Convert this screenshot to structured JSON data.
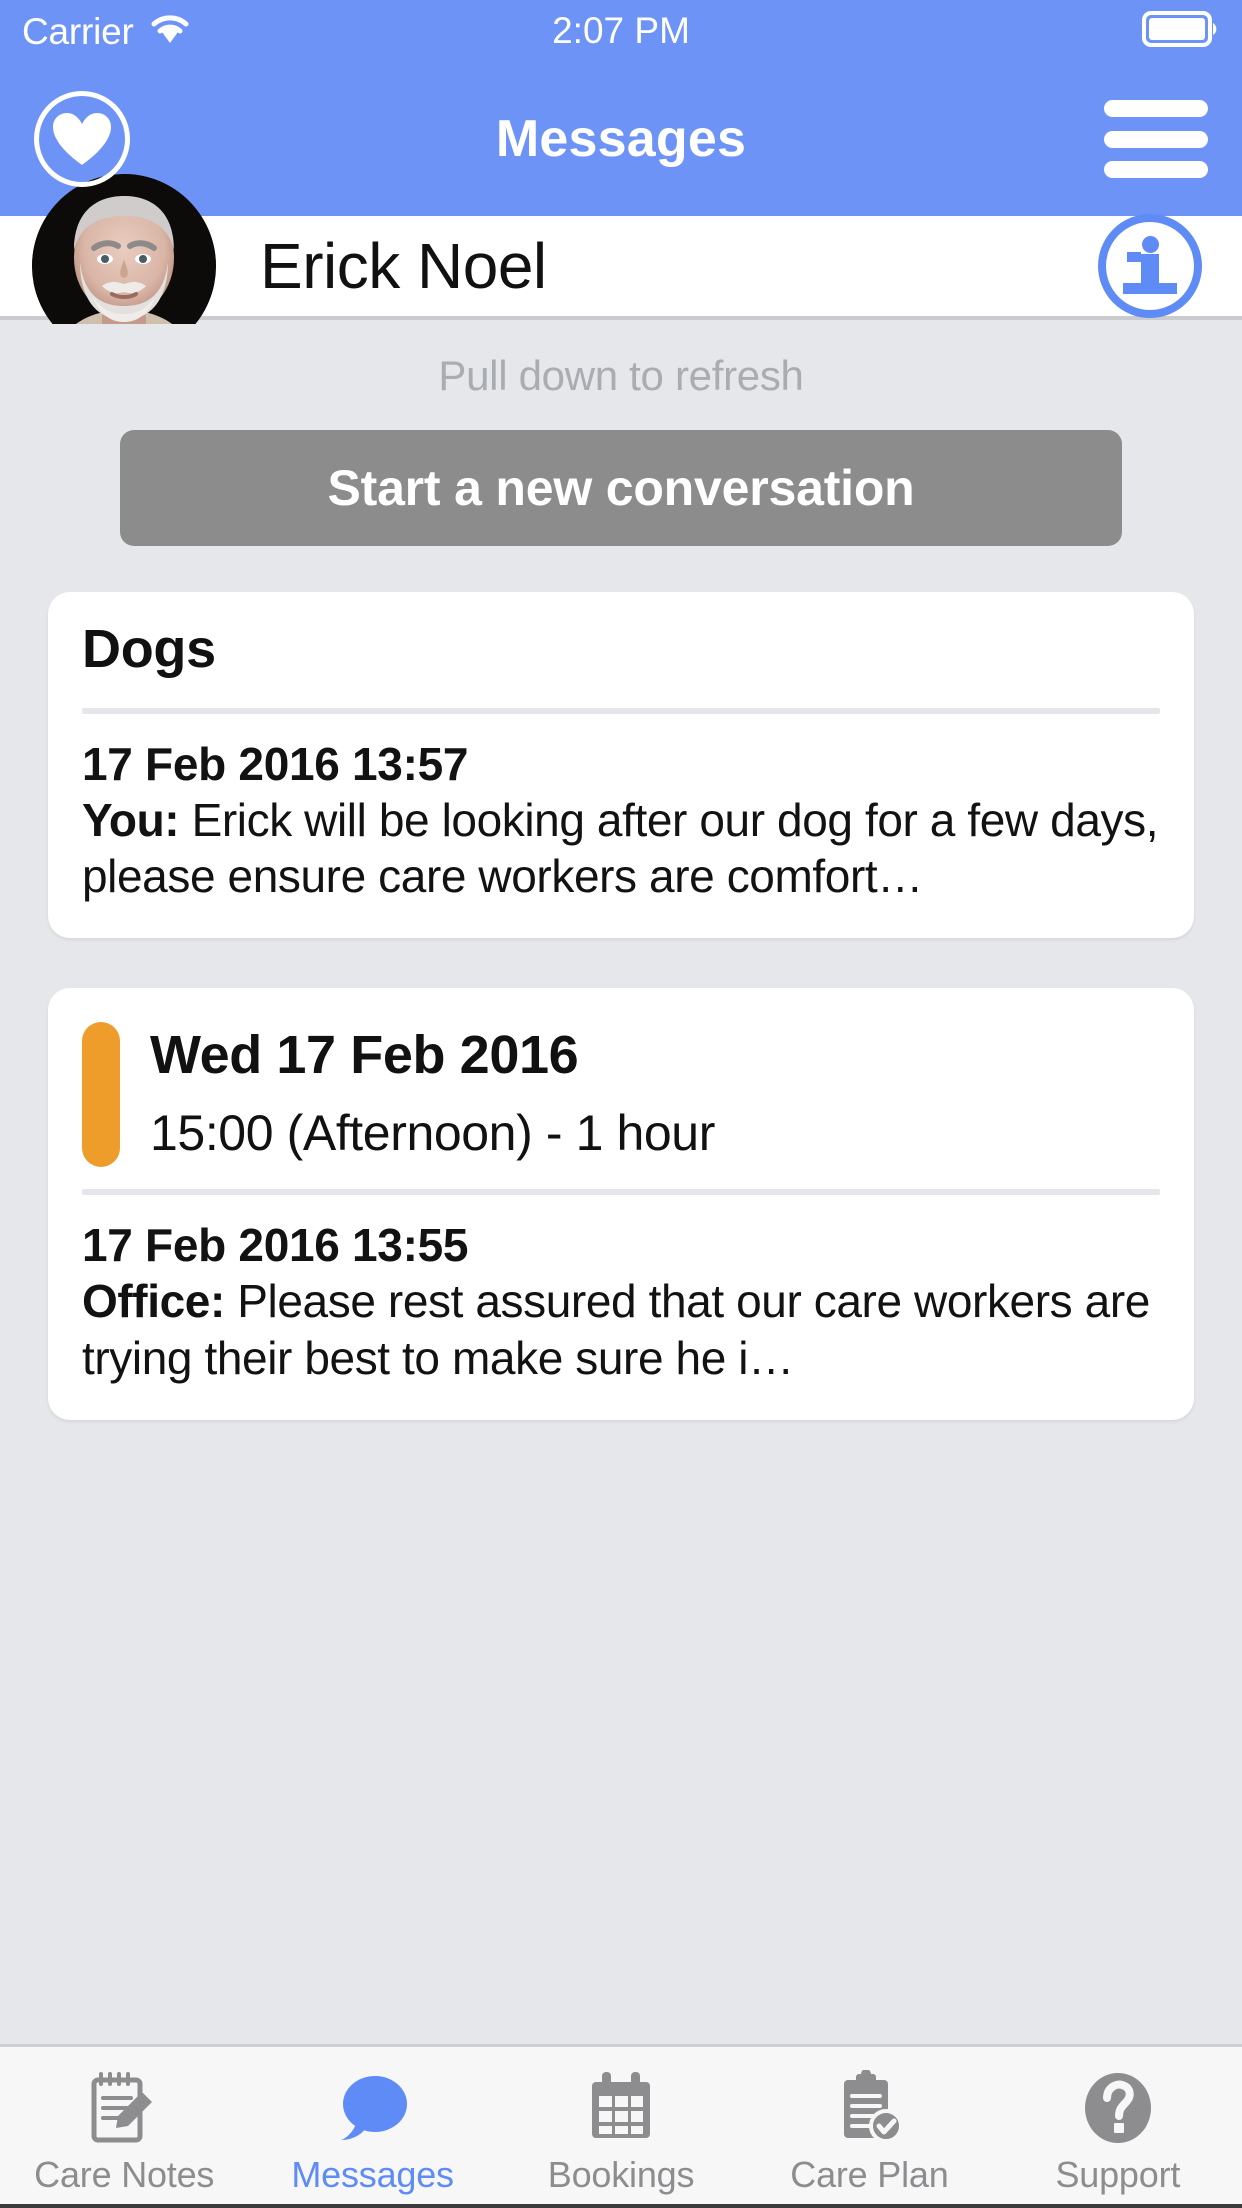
{
  "status_bar": {
    "carrier": "Carrier",
    "wifi_icon": "wifi-icon",
    "time": "2:07 PM",
    "battery_icon": "battery-full-icon"
  },
  "nav_bar": {
    "title": "Messages",
    "heart_icon": "heart-icon",
    "menu_icon": "hamburger-menu-icon",
    "background_color": "#6E93F7"
  },
  "contact_header": {
    "name": "Erick Noel",
    "avatar_icon": "avatar-photo",
    "info_icon": "info-circle-icon",
    "info_color": "#5E8BF6"
  },
  "content": {
    "pull_to_refresh": "Pull down to refresh",
    "new_conversation_label": "Start a new conversation",
    "new_conversation_color": "#8C8C8C"
  },
  "conversations": [
    {
      "title": "Dogs",
      "timestamp": "17 Feb 2016 13:57",
      "sender": "You:",
      "preview": " Erick will be looking after our dog for a few days, please ensure care workers are comfort…"
    }
  ],
  "booking_card": {
    "accent_color": "#EE9C2A",
    "day": "Wed 17 Feb 2016",
    "time": "15:00 (Afternoon) - 1 hour",
    "timestamp": "17 Feb 2016 13:55",
    "sender": "Office:",
    "preview": " Please rest assured that our care workers are trying their best to make sure he i…"
  },
  "tab_bar": {
    "active_color": "#5E8BF6",
    "inactive_color": "#8D8D90",
    "items": [
      {
        "label": "Care Notes",
        "icon": "notepad-pencil-icon",
        "active": false
      },
      {
        "label": "Messages",
        "icon": "speech-bubble-icon",
        "active": true
      },
      {
        "label": "Bookings",
        "icon": "calendar-icon",
        "active": false
      },
      {
        "label": "Care Plan",
        "icon": "clipboard-check-icon",
        "active": false
      },
      {
        "label": "Support",
        "icon": "question-mark-circle-icon",
        "active": false
      }
    ]
  }
}
